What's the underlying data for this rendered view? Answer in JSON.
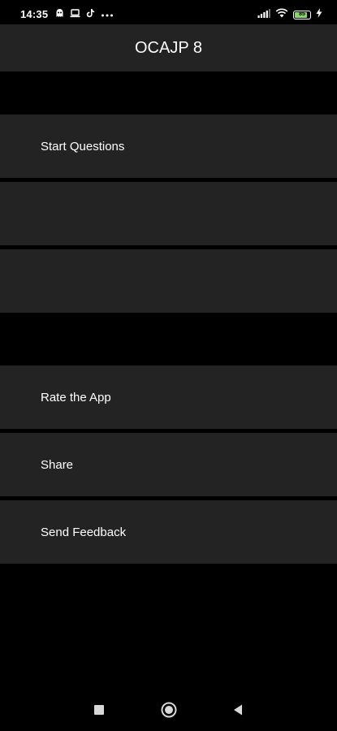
{
  "status_bar": {
    "time": "14:35",
    "left_icons": [
      "notification-ghost-icon",
      "laptop-icon",
      "tiktok-icon",
      "more-dots-icon"
    ],
    "right_icons": [
      "signal-icon",
      "wifi-icon",
      "battery-icon",
      "charging-bolt-icon"
    ],
    "battery_level": "85",
    "battery_fill_fraction": 0.85,
    "battery_color": "#8bd36f"
  },
  "app_bar": {
    "title": "OCAJP 8"
  },
  "menu": {
    "items": [
      {
        "label": "Start Questions"
      },
      {
        "label": ""
      },
      {
        "label": ""
      },
      {
        "label": "Rate the App"
      },
      {
        "label": "Share"
      },
      {
        "label": "Send Feedback"
      }
    ]
  },
  "nav_bar": {
    "buttons": [
      "recents-square-icon",
      "home-circle-icon",
      "back-triangle-icon"
    ]
  },
  "colors": {
    "background": "#000000",
    "surface": "#232323",
    "text": "#ffffff"
  }
}
